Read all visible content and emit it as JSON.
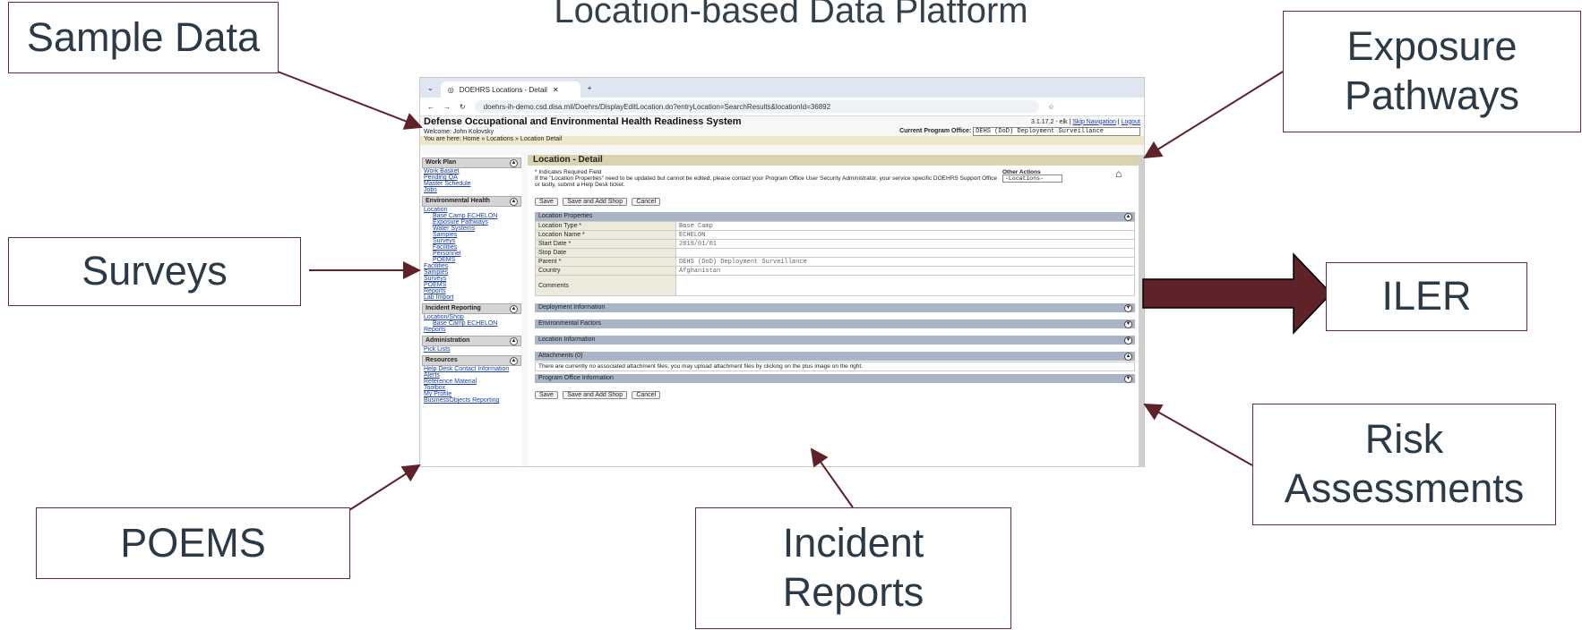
{
  "title": "Location-based Data Platform",
  "callouts": {
    "sample_data": "Sample Data",
    "surveys": "Surveys",
    "poems": "POEMS",
    "incident_reports": "Incident\nReports",
    "risk_assessments": "Risk\nAssessments",
    "iler": "ILER",
    "exposure_pathways": "Exposure\nPathways"
  },
  "colors": {
    "arrow": "#5e2229",
    "border": "#6b2a2f",
    "text": "#2b3a46"
  },
  "screenshot": {
    "tab_title": "DOEHRS Locations - Detail",
    "url": "doehrs-ih-demo.csd.disa.mil/Doehrs/DisplayEditLocation.do?entryLocation=SearchResults&locationId=36892",
    "system_name": "Defense Occupational and Environmental Health Readiness System",
    "version": "3.1.17.2 - elk",
    "skip_nav": "Skip Navigation",
    "logout": "Logout",
    "welcome": "Welcome: John Kolovsky",
    "program_office_label": "Current Program Office:",
    "program_office_value": "DEHS (DoD) Deployment Surveillance",
    "breadcrumb": "You are here: Home » Locations » Location Detail",
    "left": {
      "work_plan": "Work Plan",
      "work_plan_links": [
        "Work Basket",
        "Pending QA",
        "Master Schedule",
        "Jobs"
      ],
      "env_health": "Environmental Health",
      "location_link": "Location",
      "tree_root": "Base Camp ECHELON",
      "tree_items": [
        "Exposure Pathways",
        "Water Systems",
        "Samples",
        "Surveys",
        "Facilities",
        "Personnel",
        "POEMS"
      ],
      "env_links": [
        "Facilities",
        "Samples",
        "Surveys",
        "POEMS",
        "Reports",
        "Lab Import"
      ],
      "incident": "Incident Reporting",
      "incident_links": [
        "Location/Shop",
        "Base Camp ECHELON",
        "Reports"
      ],
      "admin": "Administration",
      "admin_links": [
        "Pick Lists"
      ],
      "resources": "Resources",
      "resource_links": [
        "Help Desk Contact Information",
        "Alerts",
        "Reference Material",
        "Toolbox",
        "My Profile",
        "BusinessObjects Reporting"
      ]
    },
    "main": {
      "header": "Location - Detail",
      "note1": "* Indicates Required Field",
      "note2": "If the \"Location Properties\" need to be updated but cannot be edited, please contact your Program Office User Security Administrator, your service specific DOEHRS Support Office",
      "note3": "or lastly, submit a Help Desk ticket.",
      "other_actions_label": "Other Actions",
      "other_actions_value": "-Locations-",
      "buttons": [
        "Save",
        "Save and Add Shop",
        "Cancel"
      ],
      "props_title": "Location Properties",
      "props": [
        {
          "label": "Location Type *",
          "value": "Base Camp"
        },
        {
          "label": "Location Name *",
          "value": "ECHELON"
        },
        {
          "label": "Start Date *",
          "value": "2019/01/01"
        },
        {
          "label": "Stop Date",
          "value": ""
        },
        {
          "label": "Parent *",
          "value": "DEHS (DoD) Deployment Surveillance"
        },
        {
          "label": "Country",
          "value": "Afghanistan"
        },
        {
          "label": "Comments",
          "value": ""
        }
      ],
      "sections": [
        "Deployment Information",
        "Environmental Factors",
        "Location Information"
      ],
      "attachments": "Attachments (0)",
      "attachments_note": "There are currently no associated attachment files; you may upload attachment files by clicking on the plus image on the right.",
      "program_info": "Program Office Information"
    }
  }
}
